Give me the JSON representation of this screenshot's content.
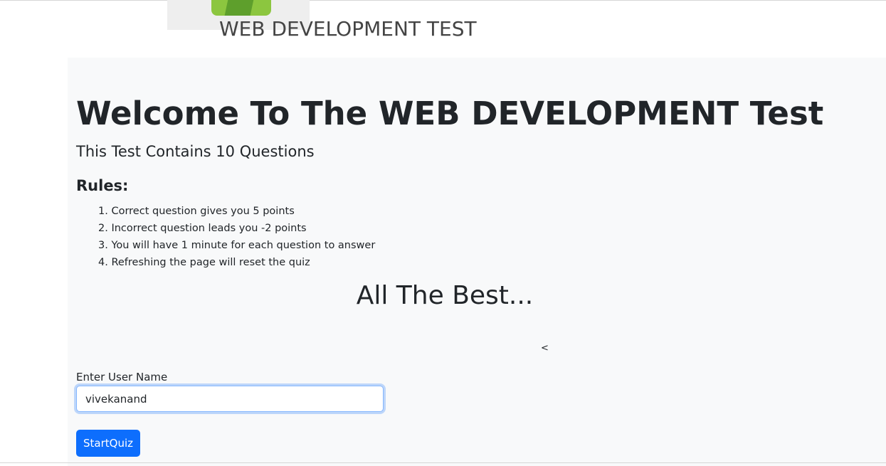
{
  "header": {
    "title": "WEB DEVELOPMENT TEST"
  },
  "main": {
    "welcome_heading": "Welcome To The WEB DEVELOPMENT Test",
    "subtitle": "This Test Contains 10 Questions",
    "rules_heading": "Rules:",
    "rules": [
      "Correct question gives you 5 points",
      "Incorrect question leads you -2 points",
      "You will have 1 minute for each question to answer",
      "Refreshing the page will reset the quiz"
    ],
    "closing_message": "All The Best...",
    "stray_char": "<"
  },
  "form": {
    "username_label": "Enter User Name",
    "username_value": "vivekanand",
    "start_button_label": "StartQuiz"
  },
  "colors": {
    "primary": "#0d6efd",
    "main_background": "#f8f9fa",
    "logo_green": "#8cc63f"
  },
  "icons": {
    "logo": "green-book-logo"
  }
}
